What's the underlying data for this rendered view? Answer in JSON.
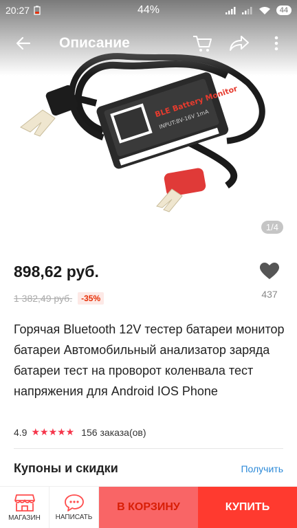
{
  "status_bar": {
    "time": "20:27",
    "battery_percent": "44%",
    "battery_badge": "44"
  },
  "nav": {
    "title": "Описание"
  },
  "gallery": {
    "counter": "1/4"
  },
  "product": {
    "price": "898,62 руб.",
    "old_price": "1 382,49 руб.",
    "discount": "-35%",
    "wishlist_count": "437",
    "title": "Горячая Bluetooth 12V тестер батареи монитор батареи Автомобильный анализатор заряда батареи тест на проворот коленвала тест напряжения для Android IOS Phone",
    "rating": "4.9",
    "stars": "★★★★★",
    "orders": "156 заказа(ов)"
  },
  "coupons": {
    "title": "Купоны и скидки",
    "action": "Получить"
  },
  "bottom_bar": {
    "store_label": "МАГАЗИН",
    "message_label": "НАПИСАТЬ",
    "cart_label": "В КОРЗИНУ",
    "buy_label": "КУПИТЬ"
  },
  "colors": {
    "accent": "#ff3a2f",
    "cart": "#f96566",
    "link": "#2c8ad8"
  },
  "icons": [
    "back-arrow-icon",
    "cart-icon",
    "share-icon",
    "more-icon",
    "heart-icon",
    "store-icon",
    "chat-icon",
    "signal-icon",
    "wifi-icon",
    "battery-icon"
  ]
}
